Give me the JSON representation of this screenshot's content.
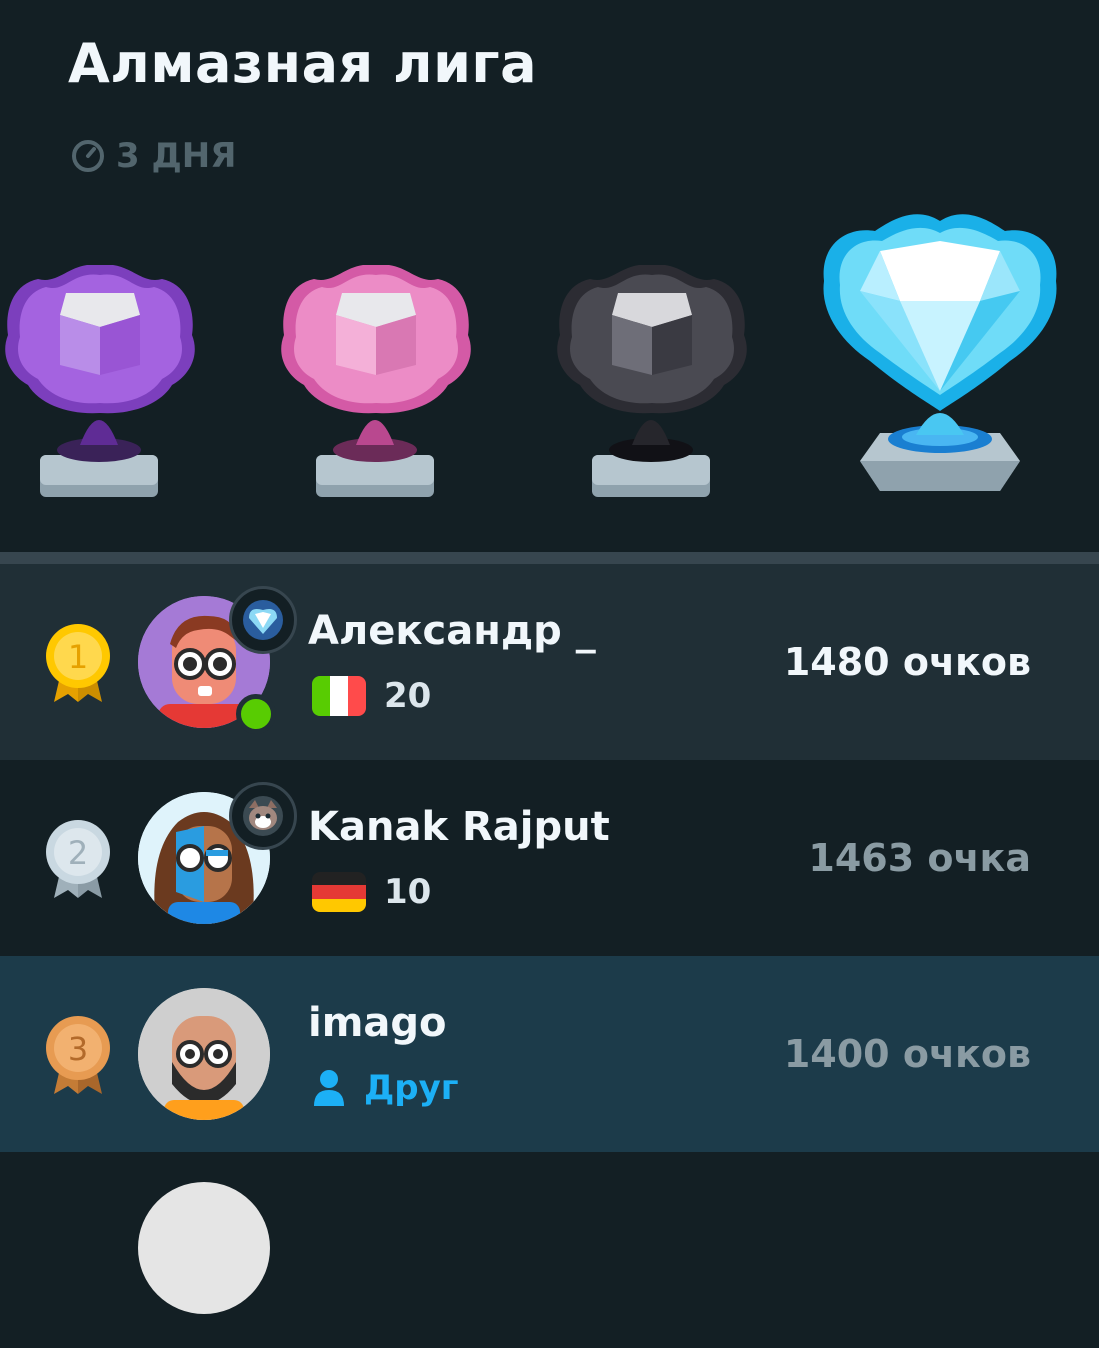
{
  "header": {
    "title": "Алмазная лига",
    "timer_text": "3 ДНЯ",
    "timer_icon": "stopwatch-icon"
  },
  "trophies": [
    {
      "name": "amethyst-trophy",
      "color": "#9b59d0"
    },
    {
      "name": "pearl-trophy",
      "color": "#e26fb4"
    },
    {
      "name": "obsidian-trophy",
      "color": "#4a4a52"
    },
    {
      "name": "diamond-trophy",
      "color": "#49c7f2"
    }
  ],
  "leaderboard": [
    {
      "rank": "1",
      "name": "Александр _",
      "flag": "italy",
      "streak": "20",
      "score": "1480 очков",
      "medal_color": "#ffc800",
      "online": true
    },
    {
      "rank": "2",
      "name": "Kanak Rajput",
      "flag": "germany",
      "streak": "10",
      "score": "1463 очка",
      "medal_color": "#c9d8e1",
      "online": false
    },
    {
      "rank": "3",
      "name": "imago",
      "friend_label": "Друг",
      "score": "1400 очков",
      "medal_color": "#e79b52",
      "online": false
    }
  ],
  "colors": {
    "background": "#131f24",
    "row_highlight": "#202f36",
    "row_user": "#1c3b4a",
    "accent_blue": "#1cb0f6",
    "online_green": "#58cc02"
  }
}
